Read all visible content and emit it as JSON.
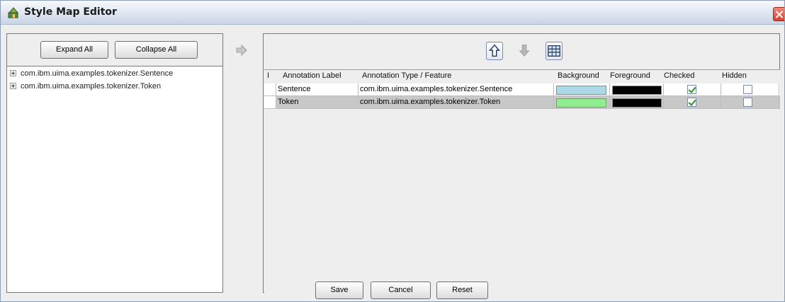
{
  "window": {
    "title": "Style Map Editor",
    "close_icon": "close-icon"
  },
  "left": {
    "expand_all": "Expand All",
    "collapse_all": "Collapse All",
    "tree_items": [
      "com.ibm.uima.examples.tokenizer.Sentence",
      "com.ibm.uima.examples.tokenizer.Token"
    ]
  },
  "toolbar": {
    "icons": [
      "arrow-up-icon",
      "arrow-down-icon",
      "table-icon"
    ],
    "add_arrow": "arrow-right-icon"
  },
  "table": {
    "headers": {
      "marker": "I",
      "label": "Annotation Label",
      "type": "Annotation Type / Feature",
      "background": "Background",
      "foreground": "Foreground",
      "checked": "Checked",
      "hidden": "Hidden"
    },
    "rows": [
      {
        "label": "Sentence",
        "type": "com.ibm.uima.examples.tokenizer.Sentence",
        "background": "#add8e6",
        "foreground": "#000000",
        "checked": true,
        "hidden": false
      },
      {
        "label": "Token",
        "type": "com.ibm.uima.examples.tokenizer.Token",
        "background": "#90ee90",
        "foreground": "#000000",
        "checked": true,
        "hidden": false
      }
    ]
  },
  "footer": {
    "save": "Save",
    "cancel": "Cancel",
    "reset": "Reset"
  }
}
